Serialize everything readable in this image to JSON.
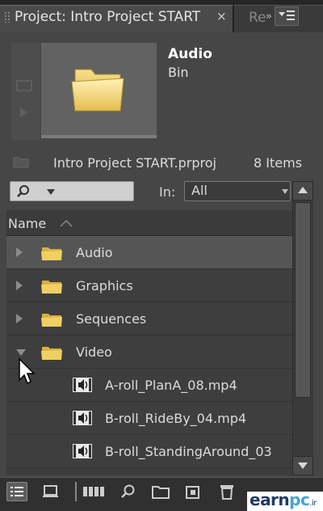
{
  "tabs": {
    "active_label": "Project: Intro Project START",
    "close_glyph": "×",
    "inactive_label": "Re",
    "overflow_glyph": "»"
  },
  "preview": {
    "bin_name": "Audio",
    "bin_type": "Bin"
  },
  "project": {
    "file_name": "Intro Project START.prproj",
    "item_count": "8 Items"
  },
  "filter": {
    "search_value": "",
    "in_label": "In:",
    "in_value": "All"
  },
  "list": {
    "column_name": "Name",
    "rows": [
      {
        "label": "Audio",
        "kind": "bin",
        "expanded": false,
        "selected": true
      },
      {
        "label": "Graphics",
        "kind": "bin",
        "expanded": false,
        "selected": false
      },
      {
        "label": "Sequences",
        "kind": "bin",
        "expanded": false,
        "selected": false
      },
      {
        "label": "Video",
        "kind": "bin",
        "expanded": true,
        "selected": false
      },
      {
        "label": "A-roll_PlanA_08.mp4",
        "kind": "clip",
        "selected": false
      },
      {
        "label": "B-roll_RideBy_04.mp4",
        "kind": "clip",
        "selected": false
      },
      {
        "label": "B-roll_StandingAround_03",
        "kind": "clip",
        "selected": false
      }
    ]
  },
  "toolbar": {
    "icons": [
      "list-view-icon",
      "icon-view-icon",
      "automate-to-sequence-icon",
      "find-icon",
      "new-bin-icon",
      "new-item-icon",
      "clear-icon"
    ]
  },
  "watermark": {
    "brand_a": "earn",
    "brand_b": "pc",
    "suffix": ".ir"
  },
  "colors": {
    "panel_bg": "#464646",
    "list_bg": "#3e3e3e",
    "selected_row": "#555555",
    "folder_yellow": "#e8c65a",
    "text": "#dcdcdc"
  }
}
